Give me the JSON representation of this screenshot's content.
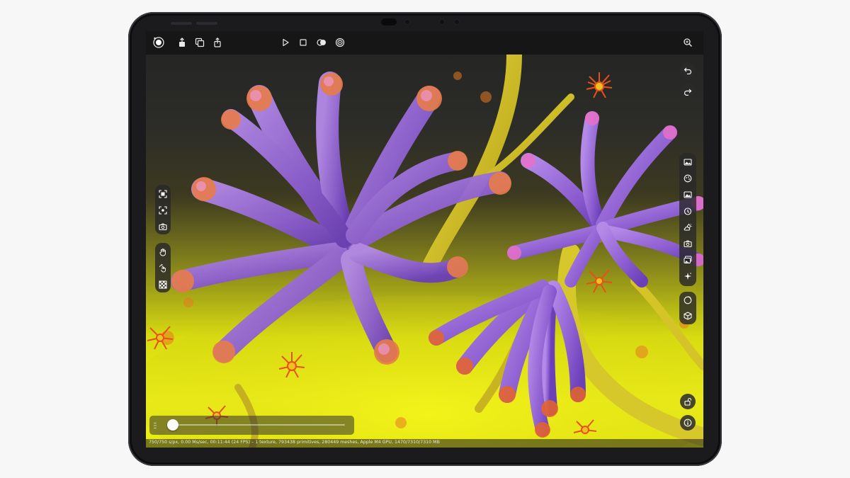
{
  "app": {
    "status_text": "750/750 s/px, 0.00 Ms/sec, 00:11:44 (24 FPS) – 1 texture, 793438 primitives, 280449 meshes, Apple M4 GPU, 1470/7310/7310 MB"
  },
  "toolbar": {
    "left_icons": [
      "render-status-icon",
      "export-icon",
      "duplicate-icon",
      "share-icon"
    ],
    "center_icons": [
      "play-icon",
      "stop-icon",
      "toggle-view-icon",
      "target-icon"
    ],
    "right_icons": [
      "zoom-icon"
    ]
  },
  "left_panel": {
    "group_1": [
      "frame-select-icon",
      "focus-icon",
      "camera-icon"
    ],
    "group_2": [
      "hand-pan-icon",
      "rotate-hand-icon",
      "checker-icon"
    ]
  },
  "right_panel": {
    "history": [
      "undo-icon",
      "redo-icon"
    ],
    "tools": [
      "image-icon",
      "palette-icon",
      "landscape-icon",
      "timer-icon",
      "sun-cloud-icon",
      "camera-icon",
      "photo-stack-icon",
      "sparkle-icon"
    ],
    "objects": [
      "sphere-icon",
      "cube-icon"
    ],
    "bottom": [
      "lock-icon",
      "info-icon"
    ]
  },
  "timeline": {
    "progress": 0.0
  },
  "colors": {
    "bezel": "#1b1b1d",
    "toolbar_bg": "#161617",
    "panel_bg": "#28282a",
    "background_yellow": "#e8ea12",
    "petal_purple": "#9b6bd6",
    "petal_magenta": "#e040e0",
    "stem_yellow": "#d4c020",
    "accent_orange": "#e85a1a"
  }
}
